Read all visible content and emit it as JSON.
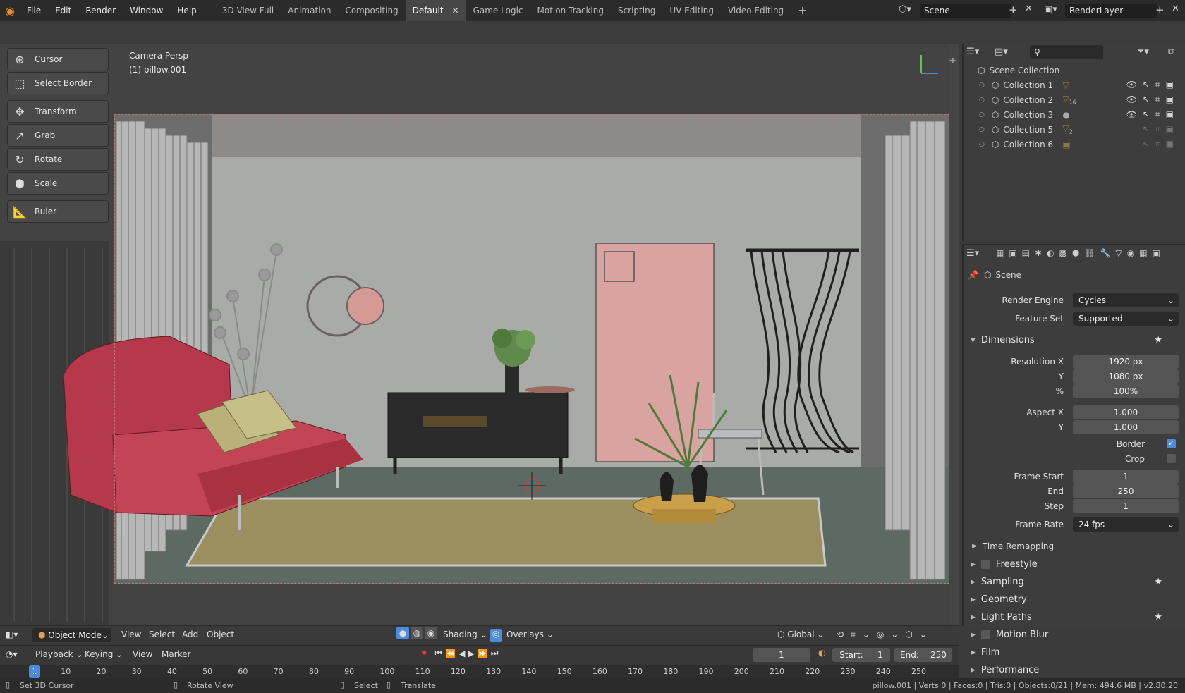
{
  "menu": [
    "File",
    "Edit",
    "Render",
    "Window",
    "Help"
  ],
  "workspaces": [
    "3D View Full",
    "Animation",
    "Compositing",
    "Default",
    "Game Logic",
    "Motion Tracking",
    "Scripting",
    "UV Editing",
    "Video Editing"
  ],
  "active_workspace": "Default",
  "scene": {
    "name": "Scene",
    "render_layer": "RenderLayer"
  },
  "viewport": {
    "view_name": "Camera Persp",
    "active_object": "(1) pillow.001"
  },
  "tools": [
    "Cursor",
    "Select Border",
    "Transform",
    "Grab",
    "Rotate",
    "Scale",
    "Ruler"
  ],
  "outliner": {
    "root": "Scene Collection",
    "collections": [
      {
        "name": "Collection 1",
        "badge": ""
      },
      {
        "name": "Collection 2",
        "badge": "16"
      },
      {
        "name": "Collection 3",
        "badge": ""
      },
      {
        "name": "Collection 5",
        "badge": "2"
      },
      {
        "name": "Collection 6",
        "badge": ""
      }
    ]
  },
  "properties": {
    "context": "Scene",
    "render_engine_label": "Render Engine",
    "render_engine": "Cycles",
    "feature_set_label": "Feature Set",
    "feature_set": "Supported",
    "dimensions": "Dimensions",
    "res_x_label": "Resolution X",
    "res_x": "1920 px",
    "res_y_label": "Y",
    "res_y": "1080 px",
    "res_pct_label": "%",
    "res_pct": "100%",
    "aspect_x_label": "Aspect X",
    "aspect_x": "1.000",
    "aspect_y_label": "Y",
    "aspect_y": "1.000",
    "border_label": "Border",
    "crop_label": "Crop",
    "frame_start_label": "Frame Start",
    "frame_start": "1",
    "frame_end_label": "End",
    "frame_end": "250",
    "frame_step_label": "Step",
    "frame_step": "1",
    "frame_rate_label": "Frame Rate",
    "frame_rate": "24 fps",
    "time_remapping": "Time Remapping",
    "panels": [
      "Freestyle",
      "Sampling",
      "Geometry",
      "Light Paths",
      "Motion Blur",
      "Film",
      "Performance"
    ]
  },
  "viewport_header": {
    "mode": "Object Mode",
    "menus": [
      "View",
      "Select",
      "Add",
      "Object"
    ],
    "shading": "Shading",
    "overlays": "Overlays",
    "orientation": "Global"
  },
  "timeline": {
    "menus": [
      "Playback",
      "Keying",
      "View",
      "Marker"
    ],
    "current_frame": "1",
    "start_label": "Start:",
    "start": "1",
    "end_label": "End:",
    "end": "250"
  },
  "ruler_ticks": [
    "1",
    "10",
    "20",
    "30",
    "40",
    "50",
    "60",
    "70",
    "80",
    "90",
    "100",
    "110",
    "120",
    "130",
    "140",
    "150",
    "160",
    "170",
    "180",
    "190",
    "200",
    "210",
    "220",
    "230",
    "240",
    "250"
  ],
  "status": {
    "left": [
      "Set 3D Cursor",
      "Rotate View",
      "Select",
      "Translate"
    ],
    "right": "pillow.001 | Verts:0 | Faces:0 | Tris:0 | Objects:0/21 | Mem: 494.6 MB | v2.80.20"
  },
  "colors": {
    "accent": "#4a8de0",
    "sofa": "#b5394a",
    "door": "#d9a3a0",
    "rug": "#9c8f5f",
    "floor": "#5c6a63",
    "wall": "#a7aaa7"
  }
}
